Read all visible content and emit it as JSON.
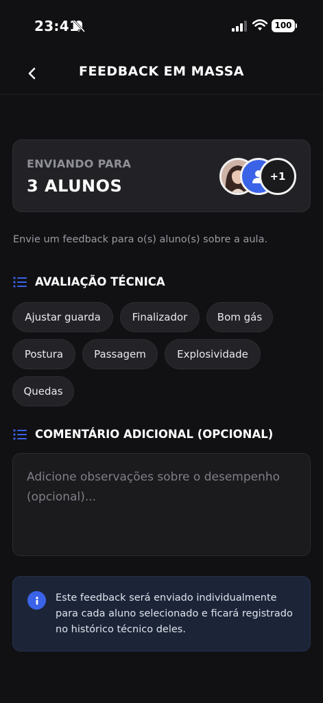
{
  "status_bar": {
    "time": "23:41",
    "battery": "100"
  },
  "nav": {
    "title": "FEEDBACK EM MASSA"
  },
  "recipients": {
    "label": "ENVIANDO PARA",
    "count": "3 ALUNOS",
    "extra": "+1"
  },
  "intro": "Envie um feedback para o(s) aluno(s) sobre a aula.",
  "technical": {
    "title": "AVALIAÇÃO TÉCNICA",
    "chips": [
      "Ajustar guarda",
      "Finalizador",
      "Bom gás",
      "Postura",
      "Passagem",
      "Explosividade",
      "Quedas"
    ]
  },
  "comment": {
    "title": "COMENTÁRIO ADICIONAL (OPCIONAL)",
    "placeholder": "Adicione observações sobre o desempenho (opcional)..."
  },
  "info": {
    "text": "Este feedback será enviado individualmente para cada aluno selecionado e ficará registrado no histórico técnico deles."
  },
  "colors": {
    "accent": "#3b63e8",
    "background": "#111113",
    "card": "#222226",
    "info_bg": "#1c2538"
  }
}
